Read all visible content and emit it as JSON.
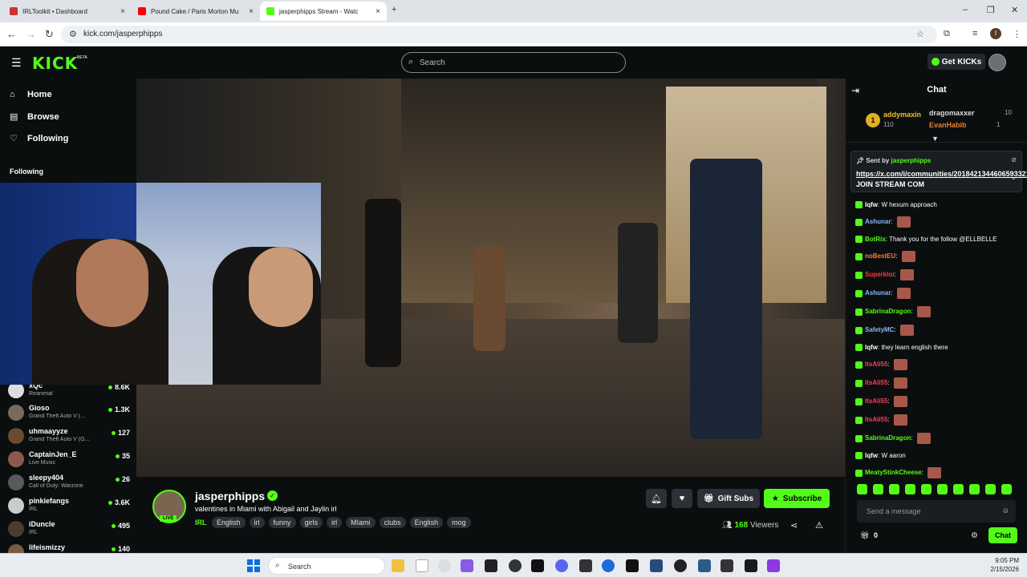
{
  "browser": {
    "tabs": [
      {
        "title": "IRLToolkit • Dashboard",
        "color": "#d32f2f"
      },
      {
        "title": "Pound Cake / Paris Morton Mu",
        "color": "#ff0000"
      },
      {
        "title": "jasperphipps Stream - Watc",
        "color": "#53fc18"
      }
    ],
    "url": "kick.com/jasperphipps",
    "new_tab": "+",
    "back": "←",
    "forward": "→",
    "reload": "↻",
    "profile_initial": "I"
  },
  "header": {
    "logo": "KICK",
    "logo_badge": "BETA",
    "search_placeholder": "Search",
    "get_kicks": "Get KICKs"
  },
  "sidebar": {
    "nav": [
      {
        "label": "Home",
        "icon": "home-icon"
      },
      {
        "label": "Browse",
        "icon": "browse-icon"
      },
      {
        "label": "Following",
        "icon": "heart-icon"
      }
    ],
    "following_title": "Following",
    "channels": [
      {
        "name": "xQc",
        "game": "Reanimal",
        "viewers": "8.6K"
      },
      {
        "name": "Gioso",
        "game": "Grand Theft Auto V (...",
        "viewers": "1.3K"
      },
      {
        "name": "uhmaayyze",
        "game": "Grand Theft Auto V (G...",
        "viewers": "127"
      },
      {
        "name": "CaptainJen_E",
        "game": "Live Music",
        "viewers": "35"
      },
      {
        "name": "sleepy404",
        "game": "Call of Duty: Warzone",
        "viewers": "26"
      },
      {
        "name": "pinkiefangs",
        "game": "IRL",
        "viewers": "3.6K"
      },
      {
        "name": "iDuncle",
        "game": "IRL",
        "viewers": "495"
      },
      {
        "name": "lifeismizzy",
        "game": "",
        "viewers": "140"
      }
    ]
  },
  "stream": {
    "channel": "jasperphipps",
    "live": "LIVE",
    "title": "valentines in Miami with Abigail and Jaylin irl",
    "category": "IRL",
    "tags": [
      "English",
      "irl",
      "funny",
      "girls",
      "irl",
      "MIami",
      "clubs",
      "English",
      "mog"
    ],
    "gift_subs": "Gift Subs",
    "subscribe": "Subscribe",
    "viewers_count": "168",
    "viewers_label": "Viewers"
  },
  "chat": {
    "title": "Chat",
    "leaderboard": [
      {
        "rank": "1",
        "name": "addymaxin",
        "points": "110"
      },
      {
        "name": "dragomaxxer",
        "points": "10"
      },
      {
        "name": "EvanHabib",
        "points": "1"
      }
    ],
    "pinned": {
      "sent_by_label": "Sent by",
      "user": "jasperphipps",
      "link": "https://x.com/i/communities/2018421344606593321",
      "text": "JOIN STREAM COM"
    },
    "messages": [
      {
        "user": "lqfw",
        "color": "#ffffff",
        "text": "W hexum approach",
        "emote": false
      },
      {
        "user": "Ashunar",
        "color": "#8ab4ff",
        "text": "",
        "emote": true
      },
      {
        "user": "BotRix",
        "color": "#53fc18",
        "text": "Thank you for the follow @ELLBELLE",
        "emote": false
      },
      {
        "user": "noBestEU",
        "color": "#ff7a3a",
        "text": "",
        "emote": true
      },
      {
        "user": "Superkloi",
        "color": "#ff3b3b",
        "text": "",
        "emote": true
      },
      {
        "user": "Ashunar",
        "color": "#8ab4ff",
        "text": "",
        "emote": true
      },
      {
        "user": "SabrinaDragon",
        "color": "#53fc18",
        "text": "",
        "emote": true
      },
      {
        "user": "SafetyMC",
        "color": "#8ab4ff",
        "text": "",
        "emote": true
      },
      {
        "user": "lqfw",
        "color": "#ffffff",
        "text": "they learn english there",
        "emote": false
      },
      {
        "user": "ItsAli55",
        "color": "#ff3b5b",
        "text": "",
        "emote": true
      },
      {
        "user": "ItsAli55",
        "color": "#ff3b5b",
        "text": "",
        "emote": true
      },
      {
        "user": "ItsAli55",
        "color": "#ff3b5b",
        "text": "",
        "emote": true
      },
      {
        "user": "ItsAli55",
        "color": "#ff3b5b",
        "text": "",
        "emote": true
      },
      {
        "user": "SabrinaDragon",
        "color": "#53fc18",
        "text": "",
        "emote": true
      },
      {
        "user": "lqfw",
        "color": "#ffffff",
        "text": "W aaron",
        "emote": false
      },
      {
        "user": "MeatyStinkCheese",
        "color": "#53fc18",
        "text": "",
        "emote": true
      }
    ],
    "input_placeholder": "Send a message",
    "gift_count": "0",
    "send": "Chat"
  },
  "taskbar": {
    "search": "Search",
    "time": "9:05 PM",
    "date": "2/15/2026"
  },
  "colors": {
    "accent": "#53fc18",
    "background": "#0b0e0f"
  }
}
